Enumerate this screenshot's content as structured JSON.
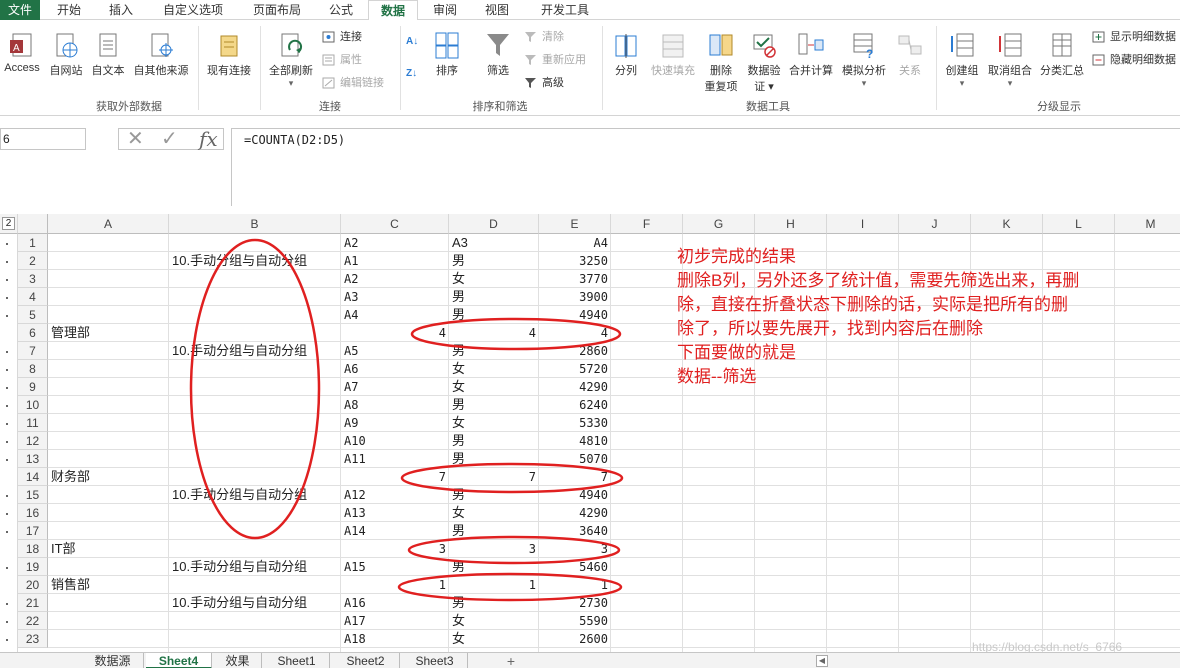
{
  "ribbon_tabs": [
    "文件",
    "开始",
    "插入",
    "自定义选项",
    "页面布局",
    "公式",
    "数据",
    "审阅",
    "视图",
    "开发工具"
  ],
  "active_tab": "数据",
  "ribbon": {
    "external": {
      "access": "Access",
      "web": "自网站",
      "text": "自文本",
      "other": "自其他来源",
      "existing": "现有连接",
      "group": "获取外部数据"
    },
    "connections": {
      "refresh_all": "全部刷新",
      "connections": "连接",
      "properties": "属性",
      "edit_links": "编辑链接",
      "group": "连接"
    },
    "sort": {
      "sort": "排序",
      "filter": "筛选",
      "clear": "清除",
      "reapply": "重新应用",
      "advanced": "高级",
      "group": "排序和筛选"
    },
    "tools": {
      "split": "分列",
      "flash": "快速填充",
      "remove_dup_1": "删除",
      "remove_dup_2": "重复项",
      "validate_1": "数据验",
      "validate_2": "证 ▾",
      "consolidate": "合并计算",
      "whatif": "模拟分析",
      "relations": "关系",
      "group": "数据工具"
    },
    "outline": {
      "group_btn": "创建组",
      "ungroup": "取消组合",
      "subtotal": "分类汇总",
      "show": "显示明细数据",
      "hide": "隐藏明细数据",
      "group": "分级显示"
    }
  },
  "formula_bar": {
    "name_box": "6",
    "formula": "=COUNTA(D2:D5)"
  },
  "columns": [
    "A",
    "B",
    "C",
    "D",
    "E",
    "F",
    "G",
    "H",
    "I",
    "J",
    "K",
    "L",
    "M"
  ],
  "outline_level": "2",
  "rows": [
    {
      "n": "1",
      "a": "",
      "b": "",
      "c": "A2",
      "d": "A3",
      "e": "A4"
    },
    {
      "n": "2",
      "a": "",
      "b": "10.手动分组与自动分组",
      "c": "A1",
      "d": "男",
      "e": "3250"
    },
    {
      "n": "3",
      "a": "",
      "b": "",
      "c": "A2",
      "d": "女",
      "e": "3770"
    },
    {
      "n": "4",
      "a": "",
      "b": "",
      "c": "A3",
      "d": "男",
      "e": "3900"
    },
    {
      "n": "5",
      "a": "",
      "b": "",
      "c": "A4",
      "d": "男",
      "e": "4940"
    },
    {
      "n": "6",
      "a": "管理部",
      "b": "",
      "c": "4",
      "d": "4",
      "e": "4"
    },
    {
      "n": "7",
      "a": "",
      "b": "10.手动分组与自动分组",
      "c": "A5",
      "d": "男",
      "e": "2860"
    },
    {
      "n": "8",
      "a": "",
      "b": "",
      "c": "A6",
      "d": "女",
      "e": "5720"
    },
    {
      "n": "9",
      "a": "",
      "b": "",
      "c": "A7",
      "d": "女",
      "e": "4290"
    },
    {
      "n": "10",
      "a": "",
      "b": "",
      "c": "A8",
      "d": "男",
      "e": "6240"
    },
    {
      "n": "11",
      "a": "",
      "b": "",
      "c": "A9",
      "d": "女",
      "e": "5330"
    },
    {
      "n": "12",
      "a": "",
      "b": "",
      "c": "A10",
      "d": "男",
      "e": "4810"
    },
    {
      "n": "13",
      "a": "",
      "b": "",
      "c": "A11",
      "d": "男",
      "e": "5070"
    },
    {
      "n": "14",
      "a": "财务部",
      "b": "",
      "c": "7",
      "d": "7",
      "e": "7"
    },
    {
      "n": "15",
      "a": "",
      "b": "10.手动分组与自动分组",
      "c": "A12",
      "d": "男",
      "e": "4940"
    },
    {
      "n": "16",
      "a": "",
      "b": "",
      "c": "A13",
      "d": "女",
      "e": "4290"
    },
    {
      "n": "17",
      "a": "",
      "b": "",
      "c": "A14",
      "d": "男",
      "e": "3640"
    },
    {
      "n": "18",
      "a": "IT部",
      "b": "",
      "c": "3",
      "d": "3",
      "e": "3"
    },
    {
      "n": "19",
      "a": "",
      "b": "10.手动分组与自动分组",
      "c": "A15",
      "d": "男",
      "e": "5460"
    },
    {
      "n": "20",
      "a": "销售部",
      "b": "",
      "c": "1",
      "d": "1",
      "e": "1"
    },
    {
      "n": "21",
      "a": "",
      "b": "10.手动分组与自动分组",
      "c": "A16",
      "d": "男",
      "e": "2730"
    },
    {
      "n": "22",
      "a": "",
      "b": "",
      "c": "A17",
      "d": "女",
      "e": "5590"
    },
    {
      "n": "23",
      "a": "",
      "b": "",
      "c": "A18",
      "d": "女",
      "e": "2600"
    }
  ],
  "annotation_lines": [
    "初步完成的结果",
    "删除B列，另外还多了统计值，需要先筛选出来，再删",
    "除，直接在折叠状态下删除的话，实际是把所有的删",
    "除了，所以要先展开，找到内容后在删除",
    "下面要做的就是",
    "数据--筛选"
  ],
  "sheet_tabs": [
    "数据源",
    "Sheet4",
    "效果",
    "Sheet1",
    "Sheet2",
    "Sheet3"
  ],
  "active_sheet": "Sheet4",
  "add_sheet": "+",
  "watermark": "https://blog.csdn.net/s_6766",
  "colors": {
    "accent": "#217346",
    "annotation": "#e02020"
  }
}
